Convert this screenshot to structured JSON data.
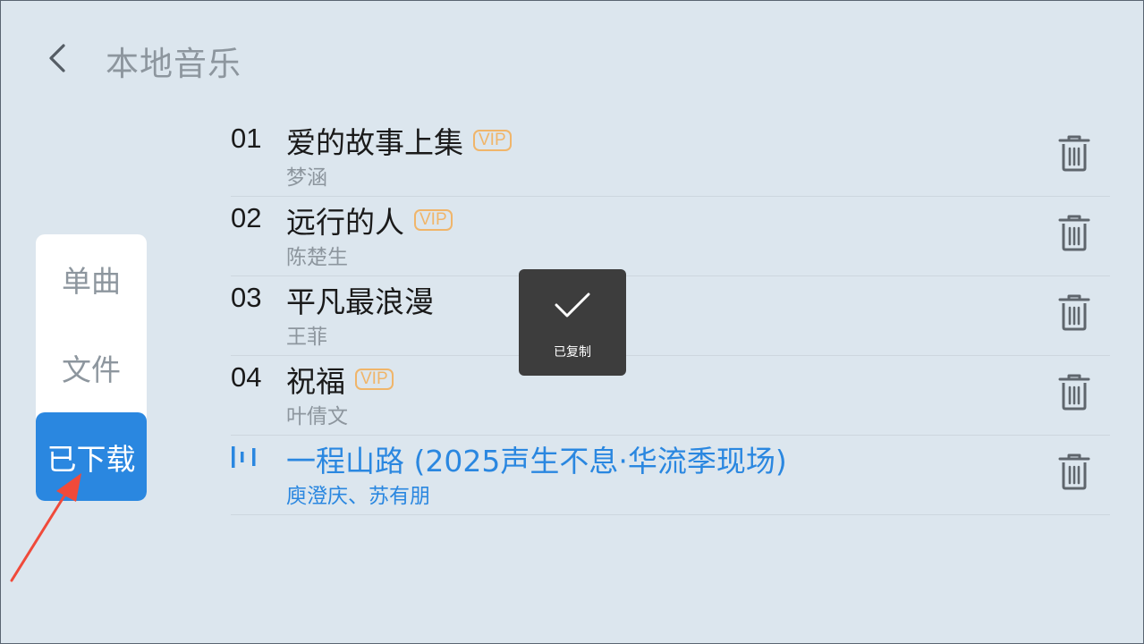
{
  "header": {
    "title": "本地音乐"
  },
  "tabs": [
    {
      "label": "单曲",
      "active": false
    },
    {
      "label": "文件",
      "active": false
    },
    {
      "label": "已下载",
      "active": true
    }
  ],
  "songs": [
    {
      "number": "01",
      "title": "爱的故事上集",
      "vip": "VIP",
      "artist": "梦涵"
    },
    {
      "number": "02",
      "title": "远行的人",
      "vip": "VIP",
      "artist": "陈楚生"
    },
    {
      "number": "03",
      "title": "平凡最浪漫",
      "vip": "",
      "artist": "王菲"
    },
    {
      "number": "04",
      "title": "祝福",
      "vip": "VIP",
      "artist": "叶倩文"
    },
    {
      "number": "",
      "title": "一程山路 (2025声生不息·华流季现场)",
      "vip": "",
      "artist": "庾澄庆、苏有朋",
      "playing": true
    }
  ],
  "toast": {
    "text": "已复制"
  },
  "colors": {
    "accent": "#2a87e0",
    "vip": "#f0b56a",
    "annotation_arrow": "#f04a3a"
  }
}
